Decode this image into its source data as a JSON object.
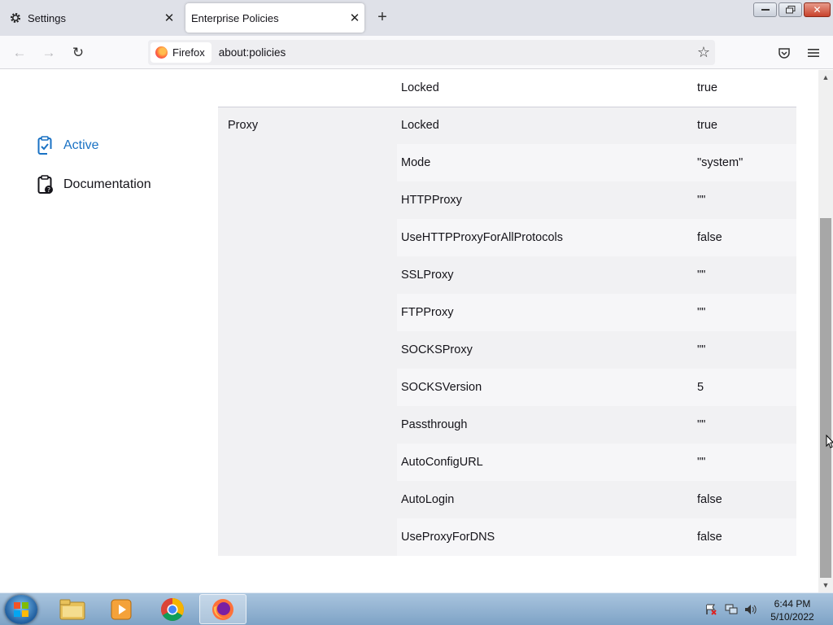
{
  "tabs": [
    {
      "label": "Settings"
    },
    {
      "label": "Enterprise Policies"
    }
  ],
  "icons": {
    "settings_tab": "gear-icon",
    "close": "close-icon",
    "new_tab": "plus-icon",
    "back": "arrow-left-icon",
    "forward": "arrow-right-icon",
    "reload": "reload-icon",
    "bookmark": "star-icon",
    "pocket": "pocket-icon",
    "menu": "hamburger-menu-icon"
  },
  "navbar": {
    "identity_label": "Firefox",
    "url": "about:policies"
  },
  "sidebar": {
    "items": [
      {
        "label": "Active"
      },
      {
        "label": "Documentation"
      }
    ]
  },
  "policies": {
    "previous_row": {
      "key": "Locked",
      "value": "true"
    },
    "proxy": {
      "name": "Proxy",
      "rows": [
        {
          "key": "Locked",
          "value": "true"
        },
        {
          "key": "Mode",
          "value": "\"system\""
        },
        {
          "key": "HTTPProxy",
          "value": "\"\""
        },
        {
          "key": "UseHTTPProxyForAllProtocols",
          "value": "false"
        },
        {
          "key": "SSLProxy",
          "value": "\"\""
        },
        {
          "key": "FTPProxy",
          "value": "\"\""
        },
        {
          "key": "SOCKSProxy",
          "value": "\"\""
        },
        {
          "key": "SOCKSVersion",
          "value": "5"
        },
        {
          "key": "Passthrough",
          "value": "\"\""
        },
        {
          "key": "AutoConfigURL",
          "value": "\"\""
        },
        {
          "key": "AutoLogin",
          "value": "false"
        },
        {
          "key": "UseProxyForDNS",
          "value": "false"
        }
      ]
    }
  },
  "taskbar": {
    "time": "6:44 PM",
    "date": "5/10/2022"
  },
  "colors": {
    "active_accent": "#1a72c4",
    "table_bg": "#f1f1f3",
    "taskbar": "#8fb0d0"
  }
}
